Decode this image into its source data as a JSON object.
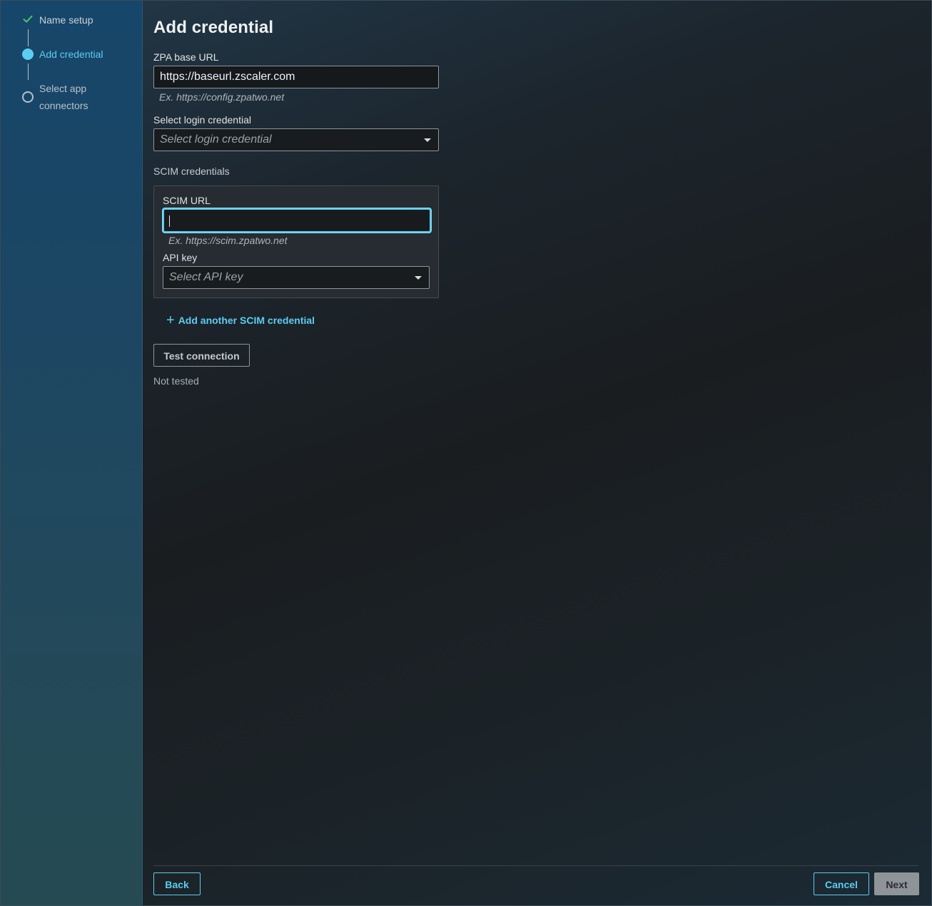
{
  "sidebar": {
    "steps": [
      {
        "label": "Name setup",
        "state": "complete",
        "icon": "check-icon"
      },
      {
        "label": "Add credential",
        "state": "active",
        "icon": "active-step-dot"
      },
      {
        "label": "Select app connectors",
        "state": "pending",
        "icon": "pending-step-circle"
      }
    ]
  },
  "main": {
    "title": "Add credential",
    "zpa_base_url": {
      "label": "ZPA base URL",
      "value": "https://baseurl.zscaler.com",
      "hint": "Ex. https://config.zpatwo.net"
    },
    "login_credential": {
      "label": "Select login credential",
      "placeholder": "Select login credential"
    },
    "scim": {
      "section_label": "SCIM credentials",
      "url_label": "SCIM URL",
      "url_value": "",
      "url_hint": "Ex. https://scim.zpatwo.net",
      "api_key_label": "API key",
      "api_key_placeholder": "Select API key"
    },
    "add_scim_label": "Add another SCIM credential",
    "test_connection_label": "Test connection",
    "test_status": "Not tested"
  },
  "footer": {
    "back_label": "Back",
    "cancel_label": "Cancel",
    "next_label": "Next"
  },
  "colors": {
    "accent": "#5ccdf0",
    "success": "#4cc96b"
  }
}
